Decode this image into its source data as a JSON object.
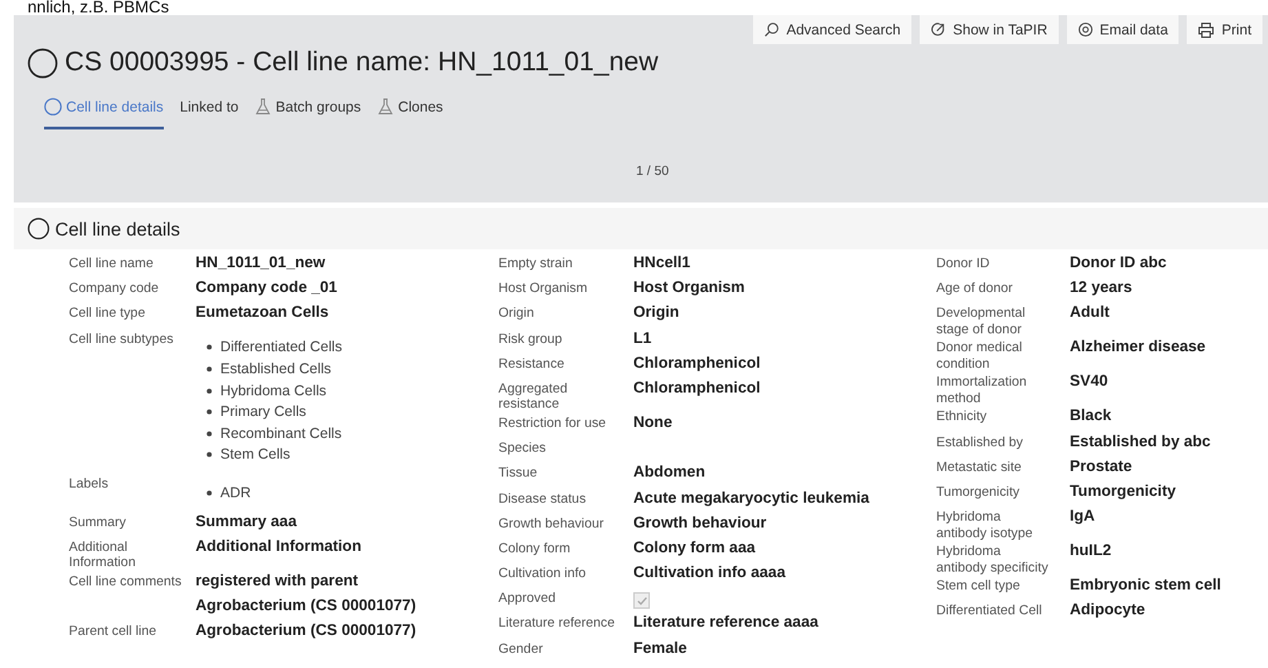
{
  "top_fragment": "nnlich, z.B. PBMCs",
  "toolbar": [
    {
      "kind": "search",
      "label": "Advanced Search"
    },
    {
      "kind": "external",
      "label": "Show in TaPIR"
    },
    {
      "kind": "email",
      "label": "Email data"
    },
    {
      "kind": "print",
      "label": "Print"
    }
  ],
  "title": "CS 00003995 - Cell line name: HN_1011_01_new",
  "tabs": [
    {
      "label": "Cell line details",
      "kind": "circle",
      "selected": true
    },
    {
      "label": "Linked to",
      "kind": "plain",
      "selected": false
    },
    {
      "label": "Batch groups",
      "kind": "flask",
      "selected": false
    },
    {
      "label": "Clones",
      "kind": "flask",
      "selected": false
    }
  ],
  "pager": "1 / 50",
  "section": {
    "title": "Cell line details"
  },
  "columns": [
    [
      {
        "label": "Cell line name",
        "kind": "text",
        "value": "HN_1011_01_new"
      },
      {
        "label": "Company code",
        "kind": "text",
        "value": "Company code _01"
      },
      {
        "label": "Cell line type",
        "kind": "text",
        "value": "Eumetazoan Cells"
      },
      {
        "label": "Cell line subtypes",
        "kind": "list",
        "items": [
          "Differentiated Cells",
          "Established Cells",
          "Hybridoma Cells",
          "Primary Cells",
          "Recombinant Cells",
          "Stem Cells"
        ]
      },
      {
        "label": "Labels",
        "kind": "list",
        "items": [
          "ADR"
        ]
      },
      {
        "label": "Summary",
        "kind": "text",
        "value": "Summary aaa"
      },
      {
        "label": "Additional Information",
        "kind": "text",
        "value": "Additional Information"
      },
      {
        "label": "Cell line comments",
        "kind": "text",
        "value": "registered with parent"
      },
      {
        "kind": "text",
        "value": "Agrobacterium (CS 00001077)"
      },
      {
        "label": "Parent cell line",
        "kind": "text",
        "value": "Agrobacterium (CS 00001077)"
      }
    ],
    [
      {
        "label": "Empty strain",
        "kind": "text",
        "value": "HNcell1"
      },
      {
        "label": "Host Organism",
        "kind": "text",
        "value": "Host Organism"
      },
      {
        "label": "Origin",
        "kind": "text",
        "value": "Origin"
      },
      {
        "label": "Risk group",
        "kind": "text",
        "value": "L1"
      },
      {
        "label": "Resistance",
        "kind": "text",
        "value": "Chloramphenicol"
      },
      {
        "label": "Aggregated resistance",
        "kind": "text",
        "value": "Chloramphenicol"
      },
      {
        "label": "Restriction for use",
        "kind": "text",
        "value": "None"
      },
      {
        "label": "Species",
        "kind": "text"
      },
      {
        "label": "Tissue",
        "kind": "text",
        "value": "Abdomen"
      },
      {
        "label": "Disease status",
        "kind": "text",
        "value": "Acute megakaryocytic leukemia"
      },
      {
        "label": "Growth behaviour",
        "kind": "text",
        "value": "Growth behaviour"
      },
      {
        "label": "Colony form",
        "kind": "text",
        "value": "Colony form aaa"
      },
      {
        "label": "Cultivation info",
        "kind": "text",
        "value": "Cultivation info aaaa"
      },
      {
        "label": "Approved",
        "kind": "checkbox",
        "checked": true,
        "disabled": true
      },
      {
        "label": "Literature reference",
        "kind": "text",
        "value": "Literature reference aaaa"
      },
      {
        "label": "Gender",
        "kind": "text",
        "value": "Female"
      }
    ],
    [
      {
        "label": "Donor ID",
        "kind": "text",
        "value": "Donor ID abc"
      },
      {
        "label": "Age of donor",
        "kind": "text",
        "value": "12 years"
      },
      {
        "label": "Developmental stage of donor",
        "kind": "text",
        "value": "Adult"
      },
      {
        "label": "Donor medical condition",
        "kind": "text",
        "value": "Alzheimer disease"
      },
      {
        "label": "Immortalization method",
        "kind": "text",
        "value": "SV40"
      },
      {
        "label": "Ethnicity",
        "kind": "text",
        "value": "Black"
      },
      {
        "label": "Established by",
        "kind": "text",
        "value": "Established by abc"
      },
      {
        "label": "Metastatic site",
        "kind": "text",
        "value": "Prostate"
      },
      {
        "label": "Tumorgenicity",
        "kind": "text",
        "value": "Tumorgenicity"
      },
      {
        "label": "Hybridoma antibody isotype",
        "kind": "text",
        "value": "IgA"
      },
      {
        "label": "Hybridoma antibody specificity",
        "kind": "text",
        "value": "huIL2"
      },
      {
        "label": "Stem cell type",
        "kind": "text",
        "value": "Embryonic stem cell"
      },
      {
        "label": "Differentiated Cell",
        "kind": "text",
        "value": "Adipocyte"
      }
    ]
  ]
}
